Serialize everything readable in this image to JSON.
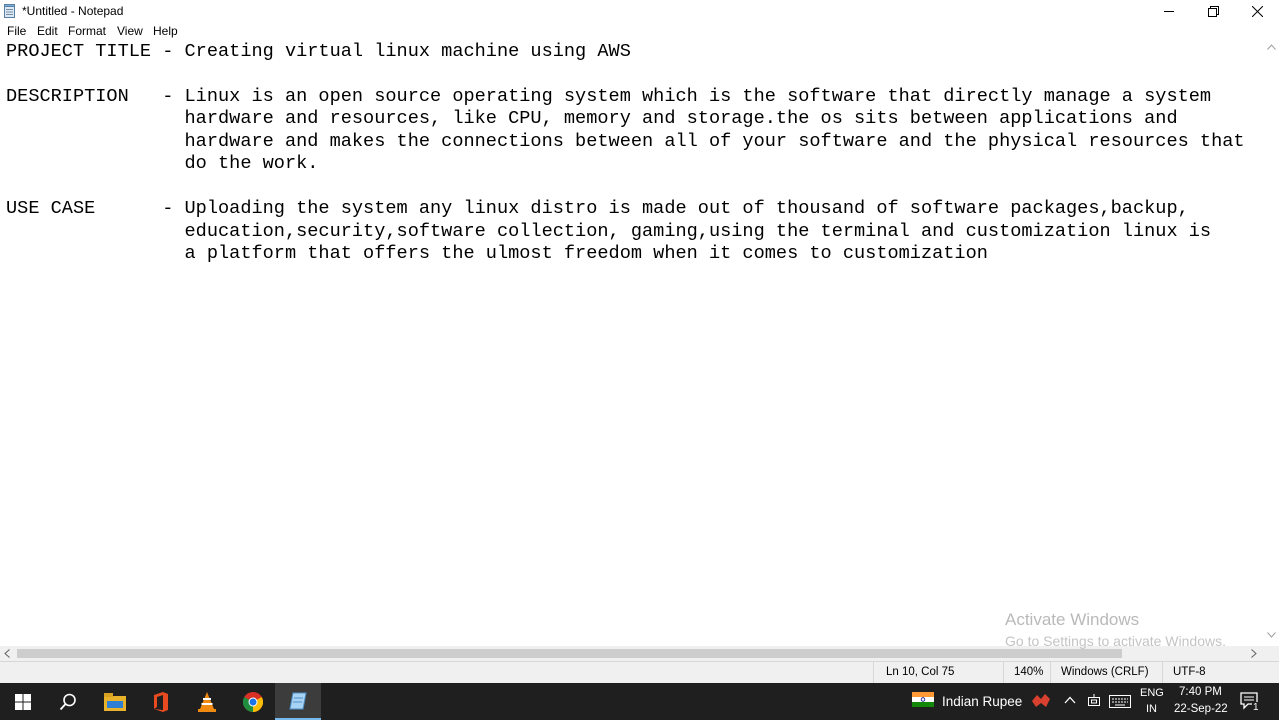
{
  "window": {
    "title": "*Untitled - Notepad",
    "icon": "notepad-icon",
    "controls": [
      "minimize-icon",
      "maximize-icon",
      "close-icon"
    ]
  },
  "menu": [
    "File",
    "Edit",
    "Format",
    "View",
    "Help"
  ],
  "document": {
    "lines": [
      "PROJECT TITLE - Creating virtual linux machine using AWS",
      "",
      "DESCRIPTION   - Linux is an open source operating system which is the software that directly manage a system",
      "                hardware and resources, like CPU, memory and storage.the os sits between applications and",
      "                hardware and makes the connections between all of your software and the physical resources that",
      "                do the work.",
      "",
      "USE CASE      - Uploading the system any linux distro is made out of thousand of software packages,backup,",
      "                education,security,software collection, gaming,using the terminal and customization linux is",
      "                a platform that offers the ulmost freedom when it comes to customization"
    ]
  },
  "watermark": {
    "line1": "Activate Windows",
    "line2": "Go to Settings to activate Windows."
  },
  "statusbar": {
    "position": "Ln 10, Col 75",
    "zoom": "140%",
    "line_ending": "Windows (CRLF)",
    "encoding": "UTF-8"
  },
  "taskbar": {
    "apps": [
      "windows-start-icon",
      "search-icon",
      "file-explorer-icon",
      "office-icon",
      "vlc-icon",
      "chrome-icon",
      "notepad-icon"
    ],
    "tray": {
      "currency": "Indian Rupee",
      "lang_top": "ENG",
      "lang_bottom": "IN",
      "time": "7:40 PM",
      "date": "22-Sep-22",
      "notification_count": "1"
    }
  }
}
